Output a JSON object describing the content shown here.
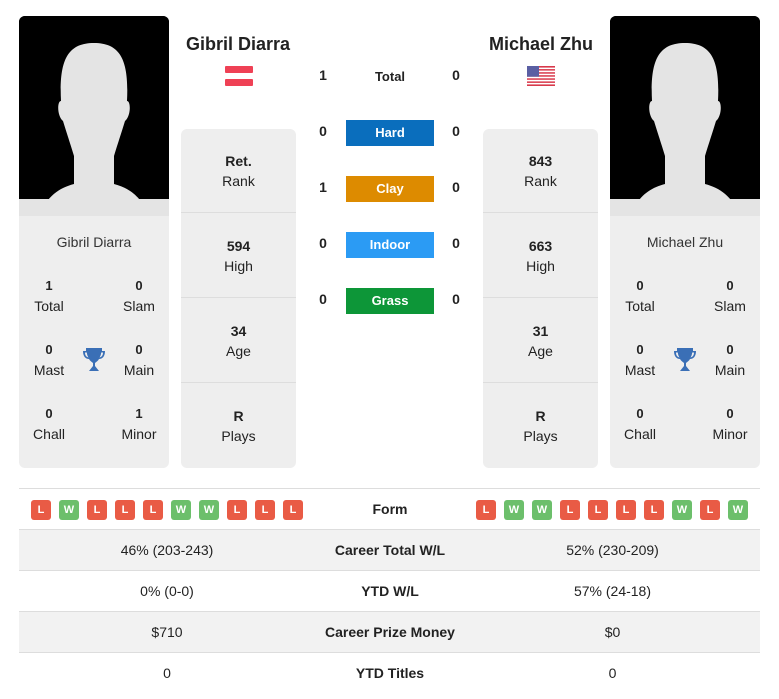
{
  "player1": {
    "name": "Gibril Diarra",
    "flag": "austria-flag",
    "titles": {
      "total": "1",
      "slam": "0",
      "mast": "0",
      "main": "0",
      "chall": "0",
      "minor": "1"
    },
    "rank": "Ret.",
    "high": "594",
    "age": "34",
    "plays": "R",
    "form": [
      "L",
      "W",
      "L",
      "L",
      "L",
      "W",
      "W",
      "L",
      "L",
      "L"
    ],
    "career_wl": "46% (203-243)",
    "ytd_wl": "0% (0-0)",
    "prize": "$710",
    "ytd_titles": "0"
  },
  "player2": {
    "name": "Michael Zhu",
    "flag": "usa-flag",
    "titles": {
      "total": "0",
      "slam": "0",
      "mast": "0",
      "main": "0",
      "chall": "0",
      "minor": "0"
    },
    "rank": "843",
    "high": "663",
    "age": "31",
    "plays": "R",
    "form": [
      "L",
      "W",
      "W",
      "L",
      "L",
      "L",
      "L",
      "W",
      "L",
      "W"
    ],
    "career_wl": "52% (230-209)",
    "ytd_wl": "57% (24-18)",
    "prize": "$0",
    "ytd_titles": "0"
  },
  "labels": {
    "total": "Total",
    "slam": "Slam",
    "mast": "Mast",
    "main": "Main",
    "chall": "Chall",
    "minor": "Minor",
    "rank": "Rank",
    "high": "High",
    "age": "Age",
    "plays": "Plays",
    "form": "Form",
    "career_wl": "Career Total W/L",
    "ytd_wl": "YTD W/L",
    "prize": "Career Prize Money",
    "ytd_titles": "YTD Titles"
  },
  "h2h": {
    "total": {
      "label": "Total",
      "p1": "1",
      "p2": "0"
    },
    "surfaces": [
      {
        "label": "Hard",
        "p1": "0",
        "p2": "0",
        "color": "#0a6ebd"
      },
      {
        "label": "Clay",
        "p1": "1",
        "p2": "0",
        "color": "#dd8b00"
      },
      {
        "label": "Indoor",
        "p1": "0",
        "p2": "0",
        "color": "#2b9bf4"
      },
      {
        "label": "Grass",
        "p1": "0",
        "p2": "0",
        "color": "#0d9638"
      }
    ]
  }
}
